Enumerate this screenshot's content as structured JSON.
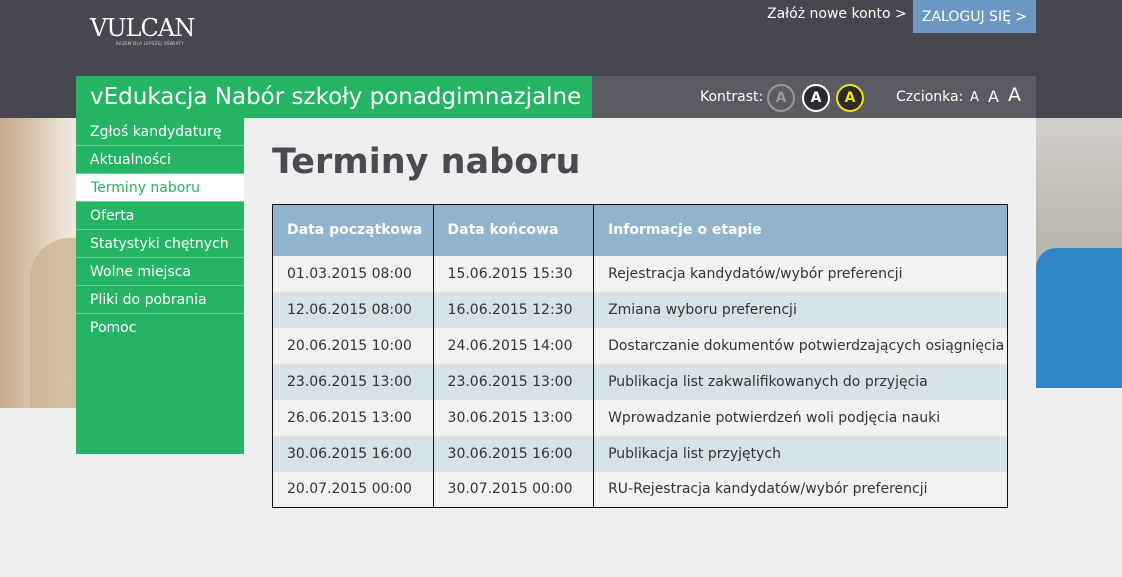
{
  "header": {
    "logo_text": "VULCAN",
    "logo_tagline": "RAZEM DLA LEPSZEJ OŚWIATY",
    "new_account_link": "Załóż nowe konto >",
    "login_button": "ZALOGUJ SIĘ >",
    "app_title": "vEdukacja Nabór szkoły ponadgimnazjalne"
  },
  "accessibility": {
    "contrast_label": "Kontrast:",
    "contrast_options": [
      "A",
      "A",
      "A"
    ],
    "font_label": "Czcionka:",
    "font_options": [
      "A",
      "A",
      "A"
    ]
  },
  "sidebar": {
    "items": [
      {
        "label": "Zgłoś kandydaturę"
      },
      {
        "label": "Aktualności"
      },
      {
        "label": "Terminy naboru"
      },
      {
        "label": "Oferta"
      },
      {
        "label": "Statystyki chętnych"
      },
      {
        "label": "Wolne miejsca"
      },
      {
        "label": "Pliki do pobrania"
      },
      {
        "label": "Pomoc"
      }
    ],
    "active_index": 2
  },
  "main": {
    "title": "Terminy naboru",
    "table": {
      "headers": [
        "Data początkowa",
        "Data końcowa",
        "Informacje o etapie"
      ],
      "rows": [
        [
          "01.03.2015 08:00",
          "15.06.2015 15:30",
          "Rejestracja kandydatów/wybór preferencji"
        ],
        [
          "12.06.2015 08:00",
          "16.06.2015 12:30",
          "Zmiana wyboru preferencji"
        ],
        [
          "20.06.2015 10:00",
          "24.06.2015 14:00",
          "Dostarczanie dokumentów potwierdzających osiągnięcia"
        ],
        [
          "23.06.2015 13:00",
          "23.06.2015 13:00",
          "Publikacja list zakwalifikowanych do przyjęcia"
        ],
        [
          "26.06.2015 13:00",
          "30.06.2015 13:00",
          "Wprowadzanie potwierdzeń woli podjęcia nauki"
        ],
        [
          "30.06.2015 16:00",
          "30.06.2015 16:00",
          "Publikacja list przyjętych"
        ],
        [
          "20.07.2015 00:00",
          "30.07.2015 00:00",
          "RU-Rejestracja kandydatów/wybór preferencji"
        ]
      ]
    }
  },
  "colors": {
    "header_bg": "#474751",
    "accent_green": "#24b464",
    "login_blue": "#6b98c3",
    "table_header": "#92b3cc",
    "row_alt": "#d6e1e8",
    "contrast_yellow": "#f5e100"
  }
}
